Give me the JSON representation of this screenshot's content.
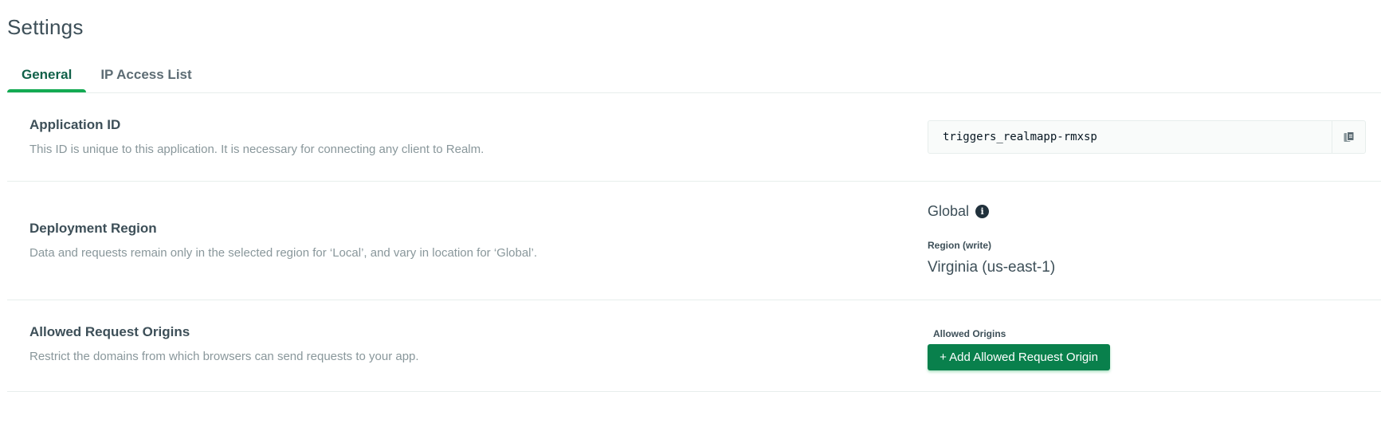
{
  "page": {
    "title": "Settings"
  },
  "tabs": [
    {
      "label": "General",
      "active": true
    },
    {
      "label": "IP Access List",
      "active": false
    }
  ],
  "sections": {
    "app_id": {
      "title": "Application ID",
      "description": "This ID is unique to this application. It is necessary for connecting any client to Realm.",
      "value": "triggers_realmapp-rmxsp",
      "copy_icon": "copy-icon"
    },
    "deployment": {
      "title": "Deployment Region",
      "description": "Data and requests remain only in the selected region for ‘Local’, and vary in location for ‘Global’.",
      "type": "Global",
      "info_icon": "info-icon",
      "region_label": "Region (write)",
      "region_value": "Virginia (us-east-1)"
    },
    "origins": {
      "title": "Allowed Request Origins",
      "description": "Restrict the domains from which browsers can send requests to your app.",
      "field_label": "Allowed Origins",
      "add_button": "+ Add Allowed Request Origin"
    }
  },
  "colors": {
    "accent": "#13aa52",
    "button": "#09804c",
    "active_tab_text": "#116149"
  }
}
